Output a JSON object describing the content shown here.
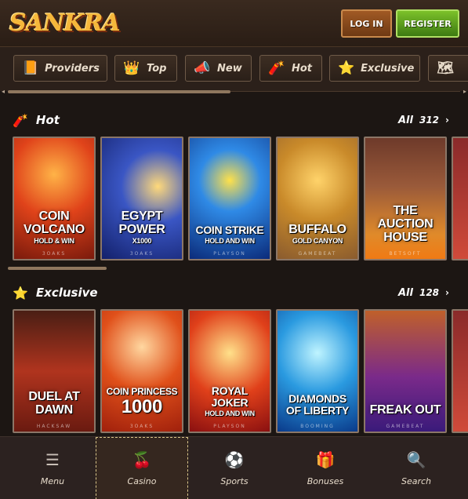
{
  "header": {
    "logo_text": "SANKRA",
    "login_label": "LOG IN",
    "register_label": "REGISTER"
  },
  "categories": [
    {
      "label": "Providers",
      "icon": "book-icon"
    },
    {
      "label": "Top",
      "icon": "crown-icon"
    },
    {
      "label": "New",
      "icon": "megaphone-icon"
    },
    {
      "label": "Hot",
      "icon": "dynamite-icon"
    },
    {
      "label": "Exclusive",
      "icon": "star-icon"
    }
  ],
  "sections": [
    {
      "title": "Hot",
      "icon": "dynamite-icon",
      "all_label": "All",
      "count": "312",
      "games": [
        {
          "title": "COIN VOLCANO",
          "sub": "HOLD & WIN",
          "provider": "3OAKS"
        },
        {
          "title": "EGYPT POWER",
          "sub": "X1000",
          "provider": "3OAKS"
        },
        {
          "title": "COIN STRIKE",
          "sub": "HOLD AND WIN",
          "provider": "PLAYSON"
        },
        {
          "title": "BUFFALO",
          "sub": "GOLD CANYON",
          "provider": "GAMEBEAT"
        },
        {
          "title": "THE AUCTION HOUSE",
          "sub": "",
          "provider": "BETSOFT"
        }
      ]
    },
    {
      "title": "Exclusive",
      "icon": "star-icon",
      "all_label": "All",
      "count": "128",
      "games": [
        {
          "title": "DUEL AT DAWN",
          "sub": "",
          "provider": "HACKSAW"
        },
        {
          "title": "1000",
          "sub": "COIN PRINCESS",
          "provider": "3OAKS"
        },
        {
          "title": "ROYAL JOKER",
          "sub": "HOLD AND WIN",
          "provider": "PLAYSON"
        },
        {
          "title": "DIAMONDS OF LIBERTY",
          "sub": "",
          "provider": "BOOMING"
        },
        {
          "title": "FREAK OUT",
          "sub": "",
          "provider": "GAMEBEAT"
        }
      ]
    }
  ],
  "bottom_nav": [
    {
      "label": "Menu",
      "icon": "hamburger-icon",
      "active": false
    },
    {
      "label": "Casino",
      "icon": "cherries-icon",
      "active": true
    },
    {
      "label": "Sports",
      "icon": "soccer-ball-icon",
      "active": false
    },
    {
      "label": "Bonuses",
      "icon": "gift-icon",
      "active": false
    },
    {
      "label": "Search",
      "icon": "search-icon",
      "active": false
    }
  ],
  "colors": {
    "background": "#1c1613",
    "login_bg": "#8a4a1c",
    "register_bg": "#5a9a1c",
    "accent_gold": "#f5b83b"
  }
}
